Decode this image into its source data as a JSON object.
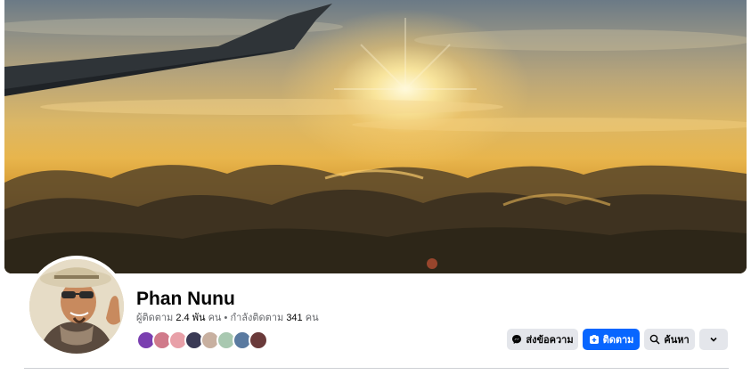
{
  "profile": {
    "name": "Phan Nunu",
    "followers_label": "ผู้ติดตาม",
    "followers_count": "2.4 พัน",
    "followers_unit": "คน",
    "separator": " • ",
    "following_label": "กำลังติดตาม",
    "following_count": "341",
    "following_unit": "คน"
  },
  "follower_avatars": [
    {
      "color": "#7a3fb0"
    },
    {
      "color": "#d07a8a"
    },
    {
      "color": "#e8a0a8"
    },
    {
      "color": "#3a3a55"
    },
    {
      "color": "#c8b0a0"
    },
    {
      "color": "#a8c8b0"
    },
    {
      "color": "#5a7aa0"
    },
    {
      "color": "#6a3a3a"
    }
  ],
  "actions": {
    "message_label": "ส่งข้อความ",
    "follow_label": "ติดตาม",
    "search_label": "ค้นหา"
  },
  "icons": {
    "message": "messenger-icon",
    "follow": "follow-icon",
    "search": "search-icon",
    "more": "chevron-down-icon"
  },
  "colors": {
    "primary": "#0866ff",
    "secondary_button": "#e4e6eb",
    "text": "#050505",
    "muted_text": "#65676b"
  }
}
